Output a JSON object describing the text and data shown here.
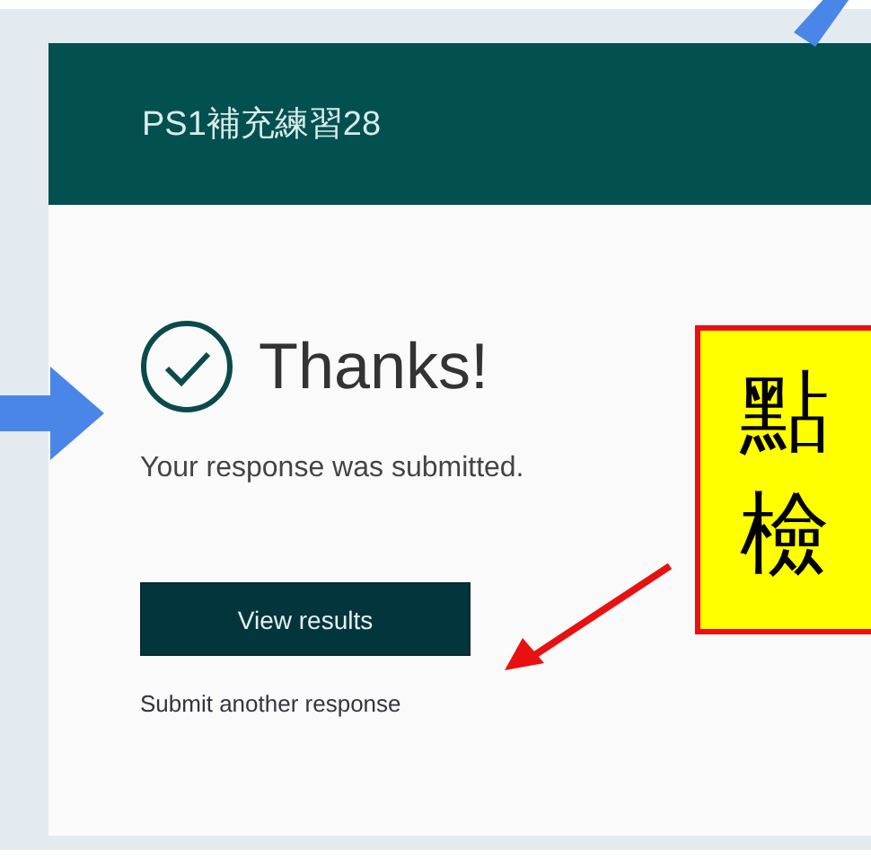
{
  "form": {
    "title": "PS1補充練習28",
    "heading": "Thanks!",
    "message": "Your response was submitted.",
    "primary_button": "View results",
    "link": "Submit another response"
  },
  "callout": {
    "lines": [
      "點",
      "檢"
    ]
  }
}
